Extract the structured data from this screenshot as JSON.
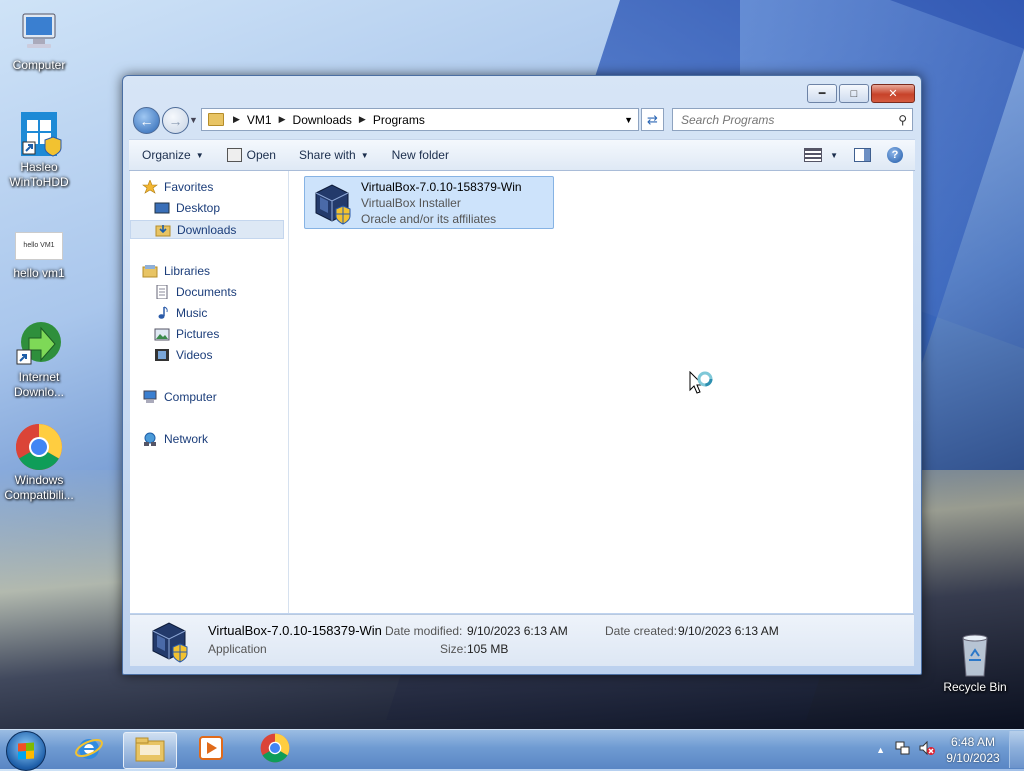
{
  "desktop": {
    "icons": [
      {
        "label": "Computer",
        "icon": "computer-icon"
      },
      {
        "label": "Hasleo\nWinToHDD",
        "icon": "hasleo-icon"
      },
      {
        "label": "hello vm1",
        "icon": "text-file-icon",
        "thumb_text": "hello VM1"
      },
      {
        "label": "Internet\nDownlo...",
        "icon": "idm-icon"
      },
      {
        "label": "Windows\nCompatibili...",
        "icon": "chrome-icon"
      },
      {
        "label": "Recycle Bin",
        "icon": "recycle-bin-icon"
      }
    ]
  },
  "window": {
    "address": {
      "crumbs": [
        "VM1",
        "Downloads",
        "Programs"
      ]
    },
    "search": {
      "placeholder": "Search Programs"
    },
    "toolbar": {
      "organize": "Organize",
      "open": "Open",
      "share_with": "Share with",
      "new_folder": "New folder"
    },
    "nav": {
      "favorites": "Favorites",
      "desktop": "Desktop",
      "downloads": "Downloads",
      "libraries": "Libraries",
      "documents": "Documents",
      "music": "Music",
      "pictures": "Pictures",
      "videos": "Videos",
      "computer": "Computer",
      "network": "Network"
    },
    "file": {
      "name": "VirtualBox-7.0.10-158379-Win",
      "description": "VirtualBox Installer",
      "company": "Oracle and/or its affiliates"
    },
    "details": {
      "name": "VirtualBox-7.0.10-158379-Win",
      "type": "Application",
      "modified_label": "Date modified:",
      "modified_value": "9/10/2023 6:13 AM",
      "size_label": "Size:",
      "size_value": "105 MB",
      "created_label": "Date created:",
      "created_value": "9/10/2023 6:13 AM"
    }
  },
  "taskbar": {
    "clock_time": "6:48 AM",
    "clock_date": "9/10/2023"
  }
}
